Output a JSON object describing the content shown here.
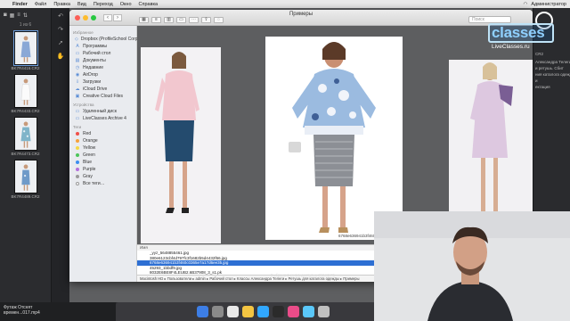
{
  "menubar": {
    "items": [
      "Finder",
      "Файл",
      "Правка",
      "Вид",
      "Переход",
      "Окно",
      "Справка"
    ],
    "user": "Администратор"
  },
  "leftstrip": {
    "count": "1 из 6",
    "thumbs": [
      {
        "name": "BK7R4416.CR2",
        "dress": "#8aa8d6"
      },
      {
        "name": "BK7R4433.CR2",
        "dress": "#ffffff"
      },
      {
        "name": "BK7R4473.CR2",
        "dress": "#7fb4c9"
      },
      {
        "name": "BK7R4489.CR2",
        "dress": "#6f9ac8"
      }
    ]
  },
  "finder": {
    "title": "Примеры",
    "search_placeholder": "Поиск",
    "sidebar": {
      "favorites_header": "Избранное",
      "favorites": [
        {
          "icon": "dropbox-icon",
          "glyph": "◇",
          "label": "Dropbox (ProfileSchool Corp)"
        },
        {
          "icon": "apps-icon",
          "glyph": "A",
          "label": "Программы"
        },
        {
          "icon": "desktop-icon",
          "glyph": "▭",
          "label": "Рабочий стол"
        },
        {
          "icon": "documents-icon",
          "glyph": "▤",
          "label": "Документы"
        },
        {
          "icon": "clock-icon",
          "glyph": "◷",
          "label": "Недавние"
        },
        {
          "icon": "airdrop-icon",
          "glyph": "◉",
          "label": "AirDrop"
        },
        {
          "icon": "download-icon",
          "glyph": "⇩",
          "label": "Загрузки"
        },
        {
          "icon": "icloud-icon",
          "glyph": "☁",
          "label": "iCloud Drive"
        },
        {
          "icon": "folder-icon",
          "glyph": "▣",
          "label": "Creative Cloud Files"
        }
      ],
      "devices_header": "Устройства",
      "devices": [
        {
          "icon": "disk-icon",
          "glyph": "▭",
          "label": "Удаленный диск"
        },
        {
          "icon": "disk-icon",
          "glyph": "▭",
          "label": "LiveClasses Archive 4"
        }
      ],
      "tags_header": "Теги",
      "tags": [
        {
          "label": "Red",
          "color": "#f0504a"
        },
        {
          "label": "Orange",
          "color": "#f7a23b"
        },
        {
          "label": "Yellow",
          "color": "#f6d845"
        },
        {
          "label": "Green",
          "color": "#4cc55a"
        },
        {
          "label": "Blue",
          "color": "#3c8ef0"
        },
        {
          "label": "Purple",
          "color": "#b46fdc"
        },
        {
          "label": "Gray",
          "color": "#9a9a9a"
        },
        {
          "label": "Все теги…",
          "color": "#ffffff"
        }
      ]
    },
    "preview": {
      "caption": "6768e636941b3f460c0365e7a17d6ee35.jpg"
    },
    "list": {
      "header": "Имя",
      "rows": [
        {
          "label": "_yyz_5648855461.jpg",
          "selected": false
        },
        {
          "label": "380e6123cbf4d797fc3f1682b5d4432f66.jpg",
          "selected": false
        },
        {
          "label": "6768e636941b3f460c0365e7a17d6ee35.jpg",
          "selected": true
        },
        {
          "label": "45293_1bbdf9.jpg",
          "selected": false
        },
        {
          "label": "8032E6BE8F4LEUB2.6B37908_3_s1.pk",
          "selected": false
        }
      ]
    },
    "pathbar": "Macintosh HD ▸ Пользователи ▸ admin ▸ Рабочий стол ▸ Классы Александра Телеги ▸ Ретушь для каталога одежды ▸ Примеры",
    "status": "Выбрано 1 из 14, доступно 392,82 ГБ"
  },
  "rightpanel": {
    "lines": [
      "CR2",
      "",
      "Александра Телеги",
      "и ретушь. Сбит",
      "ния каталога одежды",
      "и",
      "ектация"
    ]
  },
  "bottomleft": {
    "line1": "Футаж Отснят",
    "line2": "времен...017.mp4"
  },
  "watermark": {
    "brand": "classes",
    "url": "LiveClasses.ru"
  }
}
